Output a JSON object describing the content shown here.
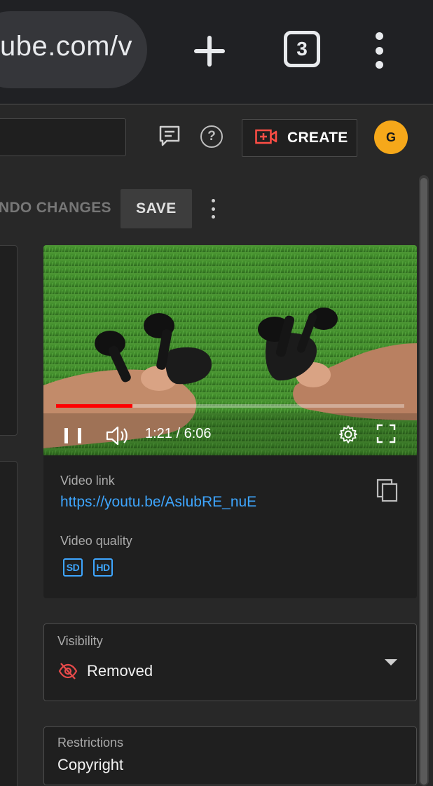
{
  "browser": {
    "url_fragment": "ube.com/v",
    "tab_count": "3"
  },
  "header": {
    "create_label": "CREATE",
    "avatar_initial": "G",
    "help_glyph": "?"
  },
  "actions": {
    "undo_label": "UNDO CHANGES",
    "undo_visible": "NDO CHANGES",
    "save_label": "SAVE"
  },
  "video": {
    "time_display": "1:21 / 6:06",
    "progress_fraction": 0.22,
    "link_label": "Video link",
    "link_url": "https://youtu.be/AslubRE_nuE",
    "quality_label": "Video quality",
    "quality_badges": [
      "SD",
      "HD"
    ]
  },
  "visibility": {
    "label": "Visibility",
    "value": "Removed"
  },
  "restrictions": {
    "label": "Restrictions",
    "value": "Copyright"
  },
  "colors": {
    "accent_link": "#3ea6ff",
    "progress_red": "#ff0000",
    "avatar_bg": "#f6a81a",
    "create_icon_red": "#ff4e45",
    "removed_icon_red": "#e84a4a"
  },
  "icons": [
    "plus-icon",
    "tabs-count-icon",
    "menu-dots-icon",
    "feedback-icon",
    "help-icon",
    "create-video-icon",
    "pause-icon",
    "volume-icon",
    "gear-icon",
    "fullscreen-icon",
    "copy-icon",
    "eye-off-icon",
    "dropdown-icon"
  ]
}
